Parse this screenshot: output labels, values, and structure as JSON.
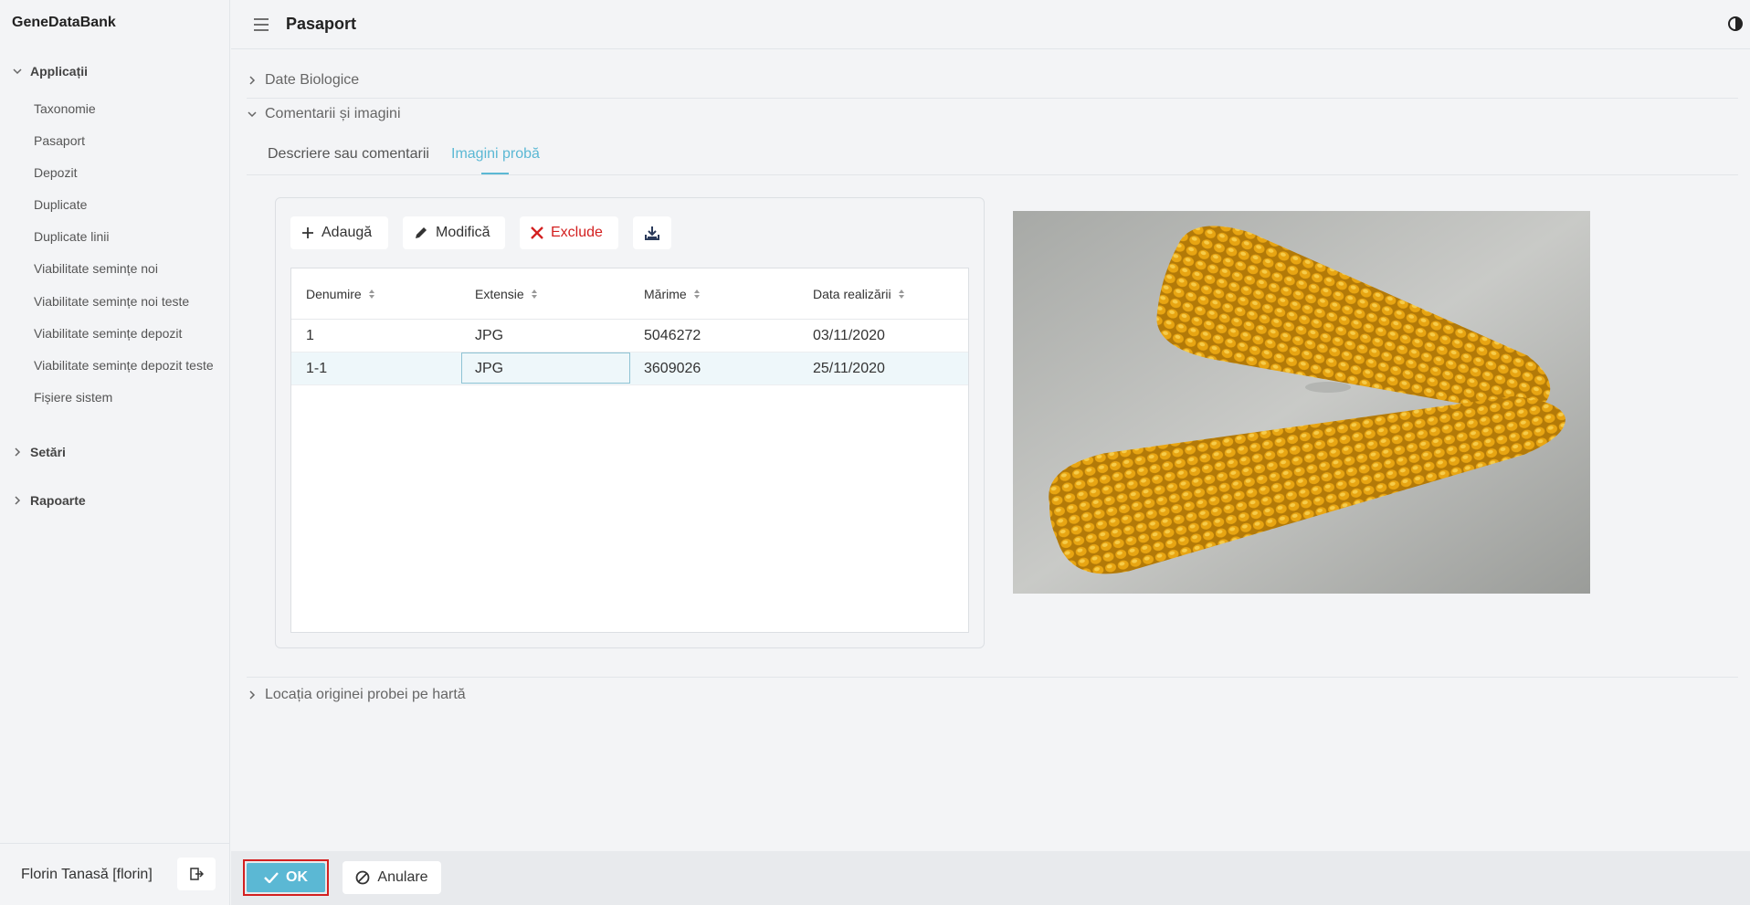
{
  "app": {
    "brand": "GeneDataBank"
  },
  "sidebar": {
    "applications_label": "Applicații",
    "items": [
      "Taxonomie",
      "Pasaport",
      "Depozit",
      "Duplicate",
      "Duplicate linii",
      "Viabilitate semințe noi",
      "Viabilitate semințe noi teste",
      "Viabilitate semințe depozit",
      "Viabilitate semințe depozit teste",
      "Fișiere sistem"
    ],
    "settings_label": "Setări",
    "reports_label": "Rapoarte",
    "user": "Florin Tanasă [florin]"
  },
  "header": {
    "title": "Pasaport"
  },
  "accordion": {
    "bio": "Date Biologice",
    "comments": "Comentarii și imagini",
    "location": "Locația originei probei pe hartă"
  },
  "tabs": {
    "description": "Descriere sau comentarii",
    "images": "Imagini probă"
  },
  "toolbar": {
    "add": "Adaugă",
    "edit": "Modifică",
    "delete": "Exclude"
  },
  "table": {
    "columns": [
      "Denumire",
      "Extensie",
      "Mărime",
      "Data realizării"
    ],
    "rows": [
      [
        "1",
        "JPG",
        "5046272",
        "03/11/2020"
      ],
      [
        "1-1",
        "JPG",
        "3609026",
        "25/11/2020"
      ]
    ]
  },
  "footer": {
    "ok": "OK",
    "cancel": "Anulare"
  },
  "colors": {
    "accent": "#5bb8d4",
    "danger": "#d32020"
  }
}
